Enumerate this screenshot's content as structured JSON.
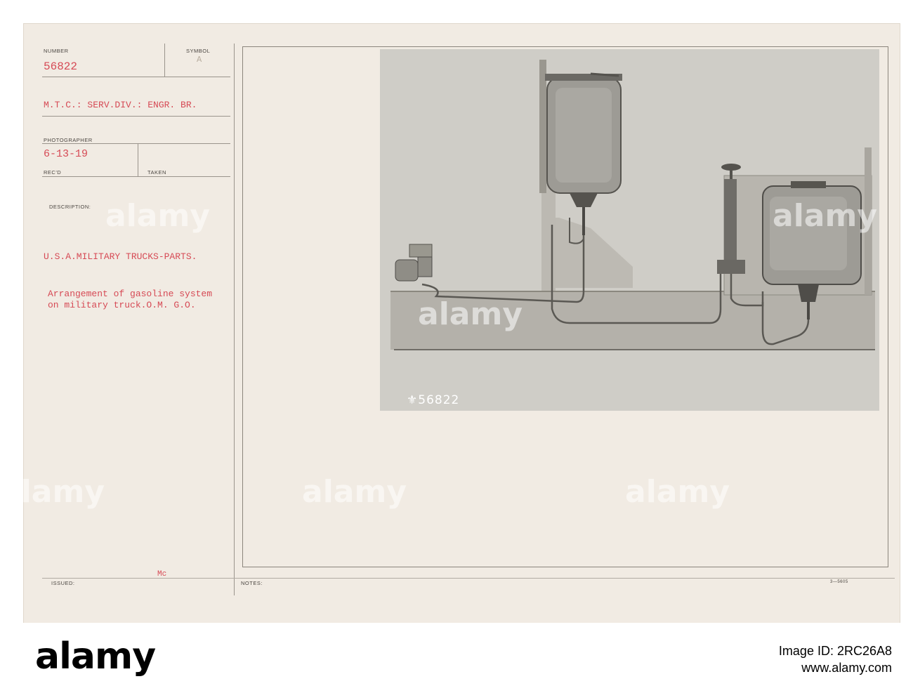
{
  "card": {
    "number_label": "NUMBER",
    "number_value": "56822",
    "symbol_label": "SYMBOL",
    "symbol_value": "A",
    "unit": "M.T.C.: SERV.DIV.: ENGR. BR.",
    "photographer_label": "PHOTOGRAPHER",
    "date_value": "6-13-19",
    "recd_label": "REC'D",
    "taken_label": "TAKEN",
    "description_label": "DESCRIPTION:",
    "title": "U.S.A.MILITARY TRUCKS-PARTS.",
    "caption_line1": "Arrangement of gasoline system",
    "caption_line2": "on military truck.O.M. G.O.",
    "issued_label": "ISSUED:",
    "issued_initials": "Mc",
    "notes_label": "NOTES:",
    "form_number": "3—5605"
  },
  "photo": {
    "negative_number": "56822",
    "description": ""
  },
  "watermark": {
    "text": "alamy"
  },
  "footer": {
    "logo": "alamy",
    "image_id_line": "Image ID: 2RC26A8",
    "url": "www.alamy.com"
  },
  "colors": {
    "card_bg": "#f1ebe3",
    "red_ink": "#d64a55",
    "photo_bg": "#cfcdc7"
  }
}
